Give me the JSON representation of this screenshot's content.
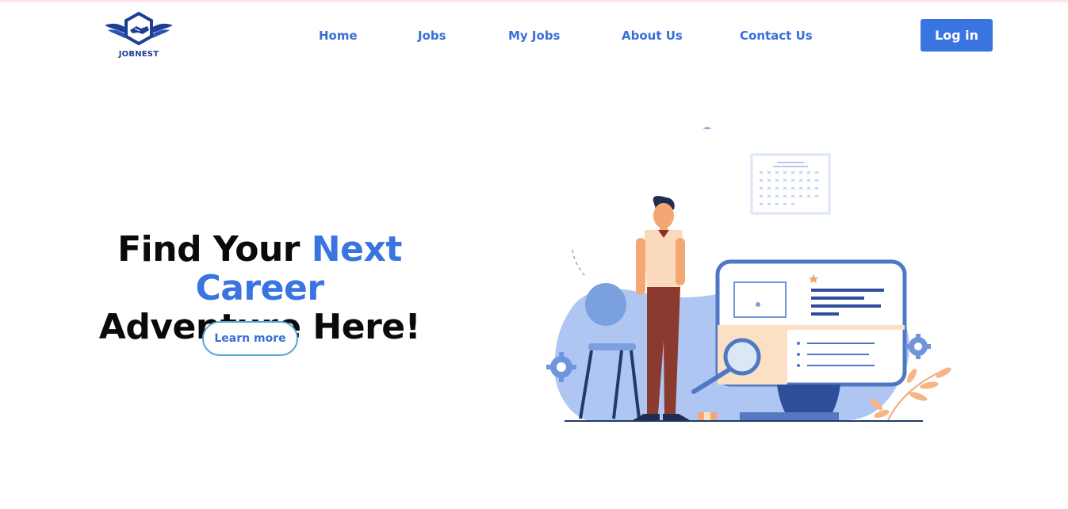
{
  "brand": {
    "name": "JOBNEST"
  },
  "nav": {
    "items": [
      {
        "label": "Home"
      },
      {
        "label": "Jobs"
      },
      {
        "label": "My Jobs"
      },
      {
        "label": "About Us"
      },
      {
        "label": "Contact Us"
      }
    ],
    "login_label": "Log in"
  },
  "hero": {
    "title_part1": "Find Your ",
    "title_accent": "Next Career",
    "title_line2": "Adventure Here!",
    "cta_label": "Learn more"
  },
  "colors": {
    "accent": "#3a74e0",
    "nav_text": "#3a6fd8",
    "heading": "#0a0a0a",
    "cta_border": "#4fa6d6"
  },
  "icons": [
    "logo-wings-handshake-icon",
    "job-search-illustration"
  ]
}
